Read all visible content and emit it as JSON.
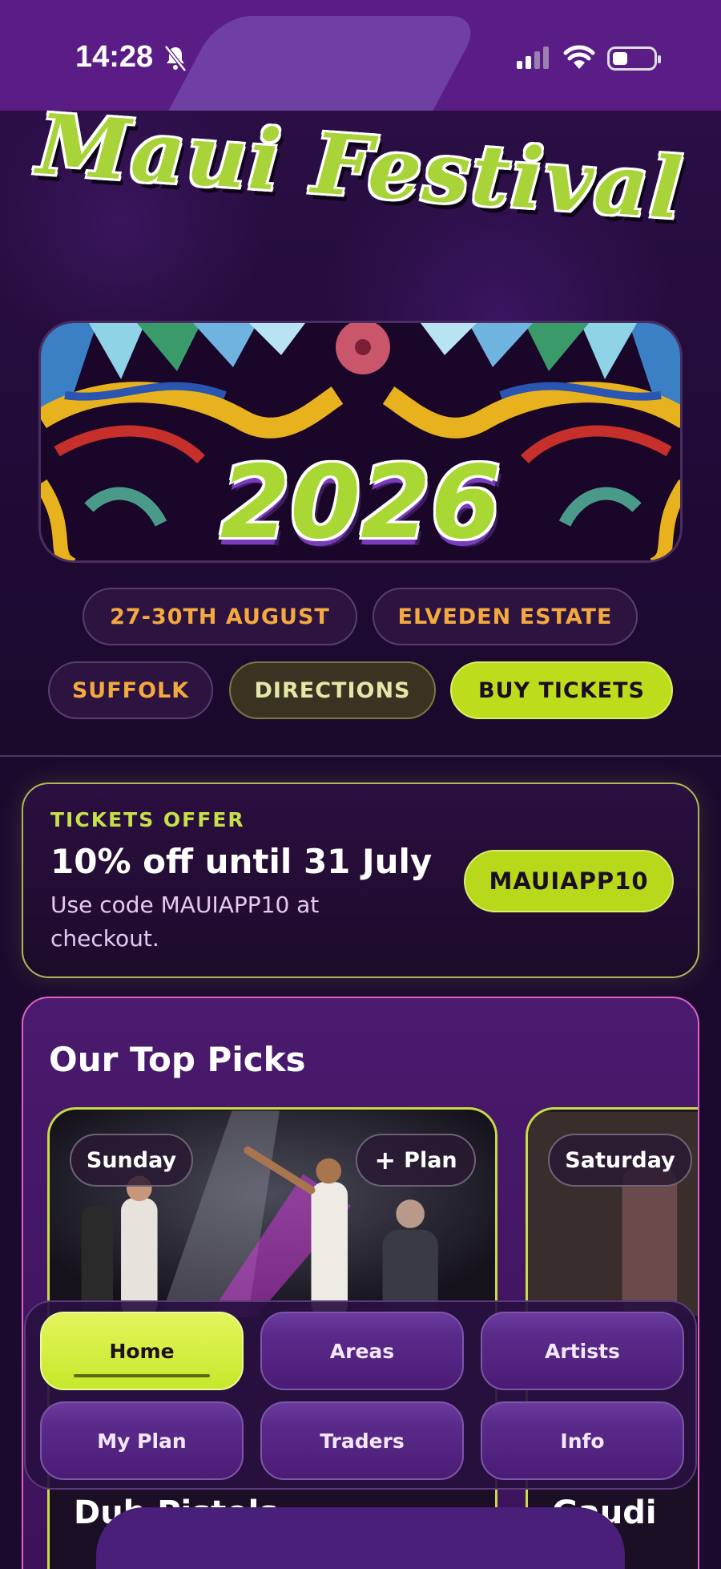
{
  "status_bar": {
    "time": "14:28"
  },
  "app": {
    "logo_text": "Maui Festival",
    "banner_year": "2026"
  },
  "event_chips": {
    "dates": "27-30TH AUGUST",
    "venue": "ELVEDEN ESTATE",
    "county": "SUFFOLK",
    "directions": "DIRECTIONS",
    "buy_tickets": "BUY TICKETS"
  },
  "offer": {
    "eyebrow": "TICKETS OFFER",
    "headline": "10% off until 31 July",
    "description": "Use code MAUIAPP10 at checkout.",
    "code": "MAUIAPP10"
  },
  "top_picks": {
    "title": "Our Top Picks",
    "cards": [
      {
        "day": "Sunday",
        "plan_label": "Plan",
        "artist": "Dub Pistols"
      },
      {
        "day": "Saturday",
        "artist": "Gaudi"
      }
    ]
  },
  "nav": {
    "items": [
      {
        "label": "Home",
        "active": true
      },
      {
        "label": "Areas",
        "active": false
      },
      {
        "label": "Artists",
        "active": false
      },
      {
        "label": "My Plan",
        "active": false
      },
      {
        "label": "Traders",
        "active": false
      },
      {
        "label": "Info",
        "active": false
      }
    ]
  },
  "colors": {
    "accent_lime": "#bddd1c",
    "accent_orange": "#f4a93f",
    "brand_purple": "#5a1d86",
    "picks_border": "#e060c8"
  }
}
